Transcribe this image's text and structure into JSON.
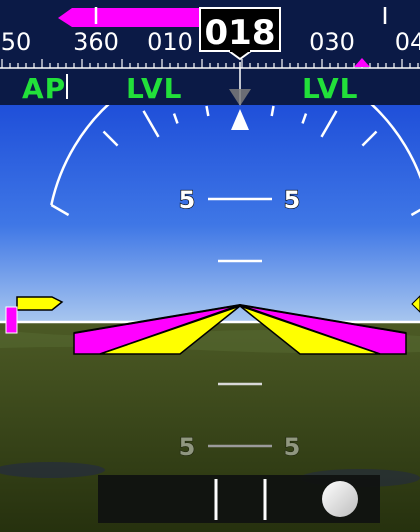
{
  "heading_tape": {
    "labels": [
      "50",
      "360",
      "010",
      "030",
      "04"
    ],
    "current_heading": "018",
    "heading_bug_color": "#ff00ff"
  },
  "autopilot": {
    "ap_label": "AP",
    "lateral_mode": "LVL",
    "vertical_mode": "LVL",
    "mode_color": "#22e03a"
  },
  "attitude": {
    "pitch_labels": {
      "up_left": "5",
      "up_right": "5",
      "down_left": "5",
      "down_right": "5"
    },
    "colors": {
      "sky_top": "#1f4fd9",
      "sky_horizon": "#a9c7ef",
      "ground_top": "#4c5a25",
      "ground_bottom": "#26310e",
      "aircraft_symbol": "#ff00ff",
      "command_bar": "#ffff00",
      "sky_pointer": "#ffffff"
    }
  },
  "slip_indicator": {
    "ball_color": "#ffffff"
  }
}
